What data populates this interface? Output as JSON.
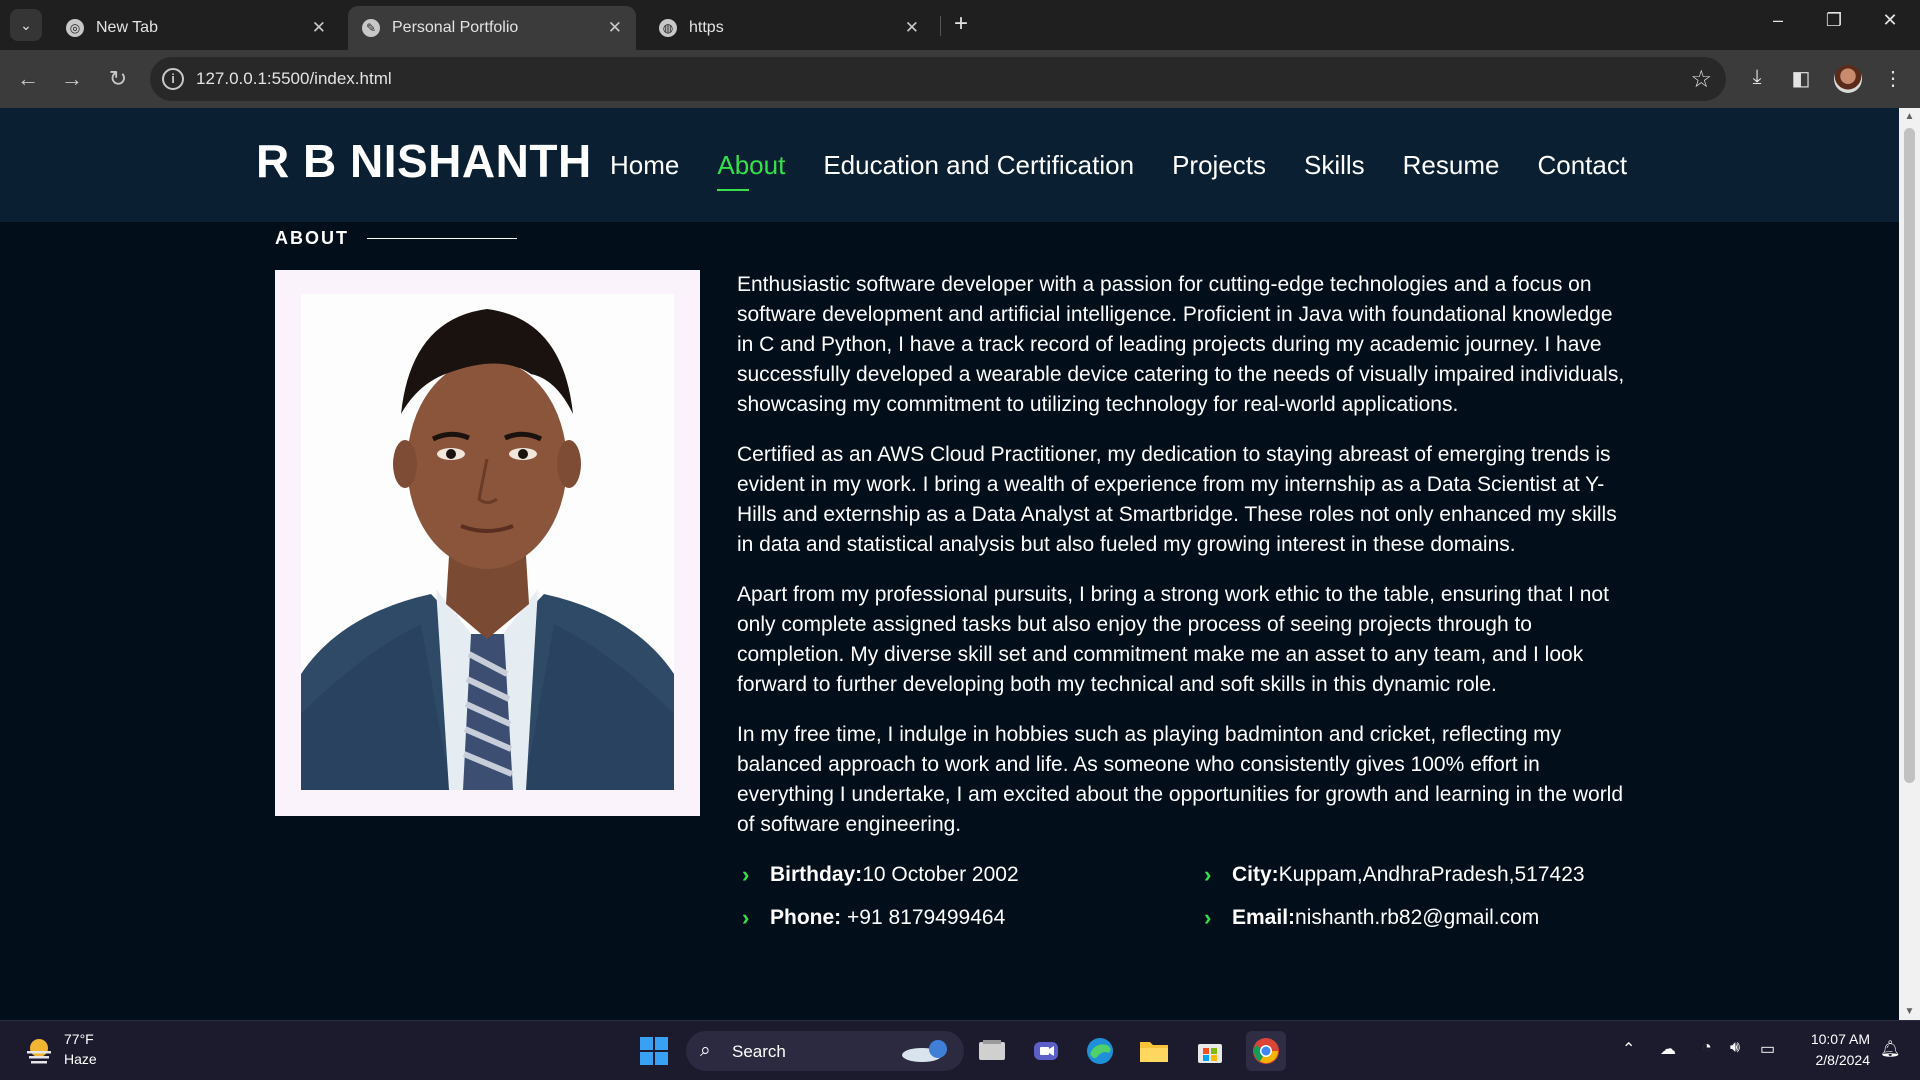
{
  "browser": {
    "tabs": [
      {
        "title": "New Tab",
        "active": false
      },
      {
        "title": "Personal Portfolio",
        "active": true
      },
      {
        "title": "https",
        "active": false
      }
    ],
    "url": "127.0.0.1:5500/index.html"
  },
  "site": {
    "logo": "R B NISHANTH",
    "nav": [
      "Home",
      "About",
      "Education and Certification",
      "Projects",
      "Skills",
      "Resume",
      "Contact"
    ],
    "active_nav": "About"
  },
  "about": {
    "section_title": "ABOUT",
    "paragraphs": [
      "Enthusiastic software developer with a passion for cutting-edge technologies and a focus on software development and artificial intelligence. Proficient in Java with foundational knowledge in C and Python, I have a track record of leading projects during my academic journey. I have successfully developed a wearable device catering to the needs of visually impaired individuals, showcasing my commitment to utilizing technology for real-world applications.",
      "Certified as an AWS Cloud Practitioner, my dedication to staying abreast of emerging trends is evident in my work. I bring a wealth of experience from my internship as a Data Scientist at Y-Hills and externship as a Data Analyst at Smartbridge. These roles not only enhanced my skills in data and statistical analysis but also fueled my growing interest in these domains.",
      "Apart from my professional pursuits, I bring a strong work ethic to the table, ensuring that I not only complete assigned tasks but also enjoy the process of seeing projects through to completion. My diverse skill set and commitment make me an asset to any team, and I look forward to further developing both my technical and soft skills in this dynamic role.",
      "In my free time, I indulge in hobbies such as playing badminton and cricket, reflecting my balanced approach to work and life. As someone who consistently gives 100% effort in everything I undertake, I am excited about the opportunities for growth and learning in the world of software engineering."
    ],
    "details": {
      "birthday_label": "Birthday:",
      "birthday": "10 October 2002",
      "city_label": "City:",
      "city": "Kuppam,AndhraPradesh,517423",
      "phone_label": "Phone:",
      "phone": " +91 8179499464",
      "email_label": "Email:",
      "email": "nishanth.rb82@gmail.com"
    }
  },
  "taskbar": {
    "weather_temp": "77°F",
    "weather_condition": "Haze",
    "search_label": "Search",
    "time": "10:07 AM",
    "date": "2/8/2024"
  },
  "colors": {
    "accent": "#35e04b",
    "header_bg": "#0b1f33",
    "page_bg": "#020f1b"
  }
}
